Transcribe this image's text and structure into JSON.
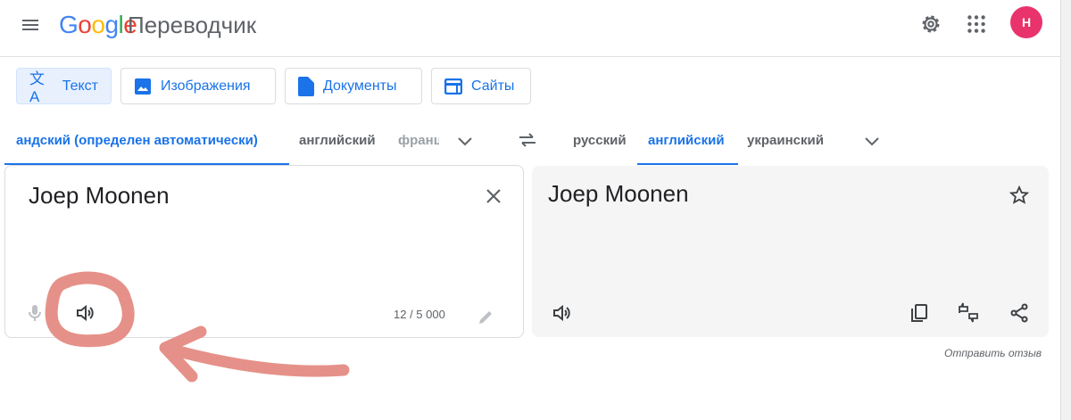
{
  "header": {
    "logo_letters": [
      "G",
      "o",
      "o",
      "g",
      "l",
      "e"
    ],
    "logo_colors": [
      "#4285f4",
      "#ea4335",
      "#fbbc05",
      "#4285f4",
      "#34a853",
      "#ea4335"
    ],
    "title": "Переводчик",
    "avatar_letter": "Н"
  },
  "modes": [
    {
      "label": "Текст",
      "icon": "translate-icon"
    },
    {
      "label": "Изображения",
      "icon": "image-icon"
    },
    {
      "label": "Документы",
      "icon": "document-icon"
    },
    {
      "label": "Сайты",
      "icon": "website-icon"
    }
  ],
  "source_langs": [
    "андский (определен автоматически)",
    "английский",
    "франц"
  ],
  "target_langs": [
    "русский",
    "английский",
    "украинский"
  ],
  "source": {
    "text": "Joep Moonen",
    "char_count": "12 / 5 000"
  },
  "target": {
    "text": "Joep Moonen"
  },
  "feedback": "Отправить отзыв",
  "colors": {
    "accent": "#1a73e8",
    "annotation": "#e59189"
  }
}
